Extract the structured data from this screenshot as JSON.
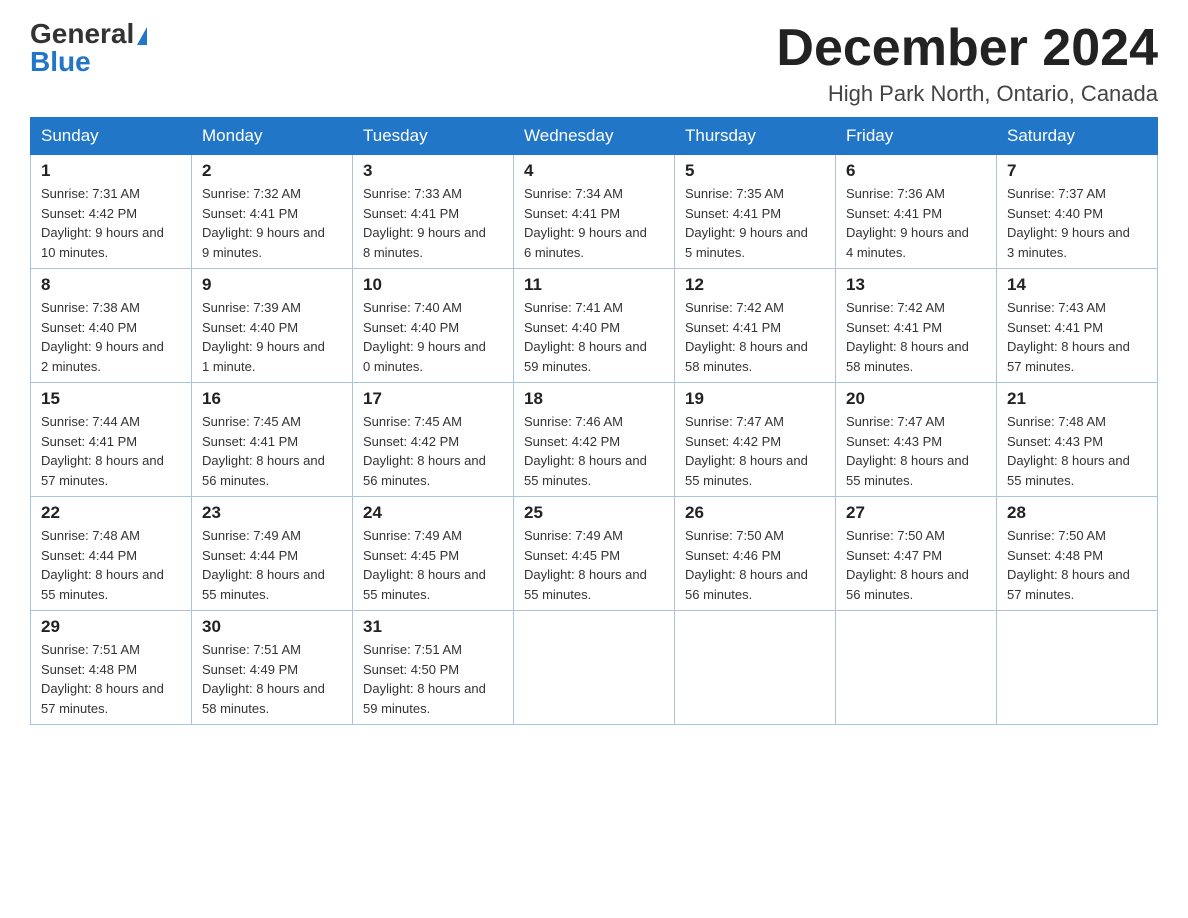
{
  "header": {
    "logo_general": "General",
    "logo_blue": "Blue",
    "month_title": "December 2024",
    "location": "High Park North, Ontario, Canada"
  },
  "days_of_week": [
    "Sunday",
    "Monday",
    "Tuesday",
    "Wednesday",
    "Thursday",
    "Friday",
    "Saturday"
  ],
  "weeks": [
    [
      {
        "day": "1",
        "sunrise": "7:31 AM",
        "sunset": "4:42 PM",
        "daylight": "9 hours and 10 minutes."
      },
      {
        "day": "2",
        "sunrise": "7:32 AM",
        "sunset": "4:41 PM",
        "daylight": "9 hours and 9 minutes."
      },
      {
        "day": "3",
        "sunrise": "7:33 AM",
        "sunset": "4:41 PM",
        "daylight": "9 hours and 8 minutes."
      },
      {
        "day": "4",
        "sunrise": "7:34 AM",
        "sunset": "4:41 PM",
        "daylight": "9 hours and 6 minutes."
      },
      {
        "day": "5",
        "sunrise": "7:35 AM",
        "sunset": "4:41 PM",
        "daylight": "9 hours and 5 minutes."
      },
      {
        "day": "6",
        "sunrise": "7:36 AM",
        "sunset": "4:41 PM",
        "daylight": "9 hours and 4 minutes."
      },
      {
        "day": "7",
        "sunrise": "7:37 AM",
        "sunset": "4:40 PM",
        "daylight": "9 hours and 3 minutes."
      }
    ],
    [
      {
        "day": "8",
        "sunrise": "7:38 AM",
        "sunset": "4:40 PM",
        "daylight": "9 hours and 2 minutes."
      },
      {
        "day": "9",
        "sunrise": "7:39 AM",
        "sunset": "4:40 PM",
        "daylight": "9 hours and 1 minute."
      },
      {
        "day": "10",
        "sunrise": "7:40 AM",
        "sunset": "4:40 PM",
        "daylight": "9 hours and 0 minutes."
      },
      {
        "day": "11",
        "sunrise": "7:41 AM",
        "sunset": "4:40 PM",
        "daylight": "8 hours and 59 minutes."
      },
      {
        "day": "12",
        "sunrise": "7:42 AM",
        "sunset": "4:41 PM",
        "daylight": "8 hours and 58 minutes."
      },
      {
        "day": "13",
        "sunrise": "7:42 AM",
        "sunset": "4:41 PM",
        "daylight": "8 hours and 58 minutes."
      },
      {
        "day": "14",
        "sunrise": "7:43 AM",
        "sunset": "4:41 PM",
        "daylight": "8 hours and 57 minutes."
      }
    ],
    [
      {
        "day": "15",
        "sunrise": "7:44 AM",
        "sunset": "4:41 PM",
        "daylight": "8 hours and 57 minutes."
      },
      {
        "day": "16",
        "sunrise": "7:45 AM",
        "sunset": "4:41 PM",
        "daylight": "8 hours and 56 minutes."
      },
      {
        "day": "17",
        "sunrise": "7:45 AM",
        "sunset": "4:42 PM",
        "daylight": "8 hours and 56 minutes."
      },
      {
        "day": "18",
        "sunrise": "7:46 AM",
        "sunset": "4:42 PM",
        "daylight": "8 hours and 55 minutes."
      },
      {
        "day": "19",
        "sunrise": "7:47 AM",
        "sunset": "4:42 PM",
        "daylight": "8 hours and 55 minutes."
      },
      {
        "day": "20",
        "sunrise": "7:47 AM",
        "sunset": "4:43 PM",
        "daylight": "8 hours and 55 minutes."
      },
      {
        "day": "21",
        "sunrise": "7:48 AM",
        "sunset": "4:43 PM",
        "daylight": "8 hours and 55 minutes."
      }
    ],
    [
      {
        "day": "22",
        "sunrise": "7:48 AM",
        "sunset": "4:44 PM",
        "daylight": "8 hours and 55 minutes."
      },
      {
        "day": "23",
        "sunrise": "7:49 AM",
        "sunset": "4:44 PM",
        "daylight": "8 hours and 55 minutes."
      },
      {
        "day": "24",
        "sunrise": "7:49 AM",
        "sunset": "4:45 PM",
        "daylight": "8 hours and 55 minutes."
      },
      {
        "day": "25",
        "sunrise": "7:49 AM",
        "sunset": "4:45 PM",
        "daylight": "8 hours and 55 minutes."
      },
      {
        "day": "26",
        "sunrise": "7:50 AM",
        "sunset": "4:46 PM",
        "daylight": "8 hours and 56 minutes."
      },
      {
        "day": "27",
        "sunrise": "7:50 AM",
        "sunset": "4:47 PM",
        "daylight": "8 hours and 56 minutes."
      },
      {
        "day": "28",
        "sunrise": "7:50 AM",
        "sunset": "4:48 PM",
        "daylight": "8 hours and 57 minutes."
      }
    ],
    [
      {
        "day": "29",
        "sunrise": "7:51 AM",
        "sunset": "4:48 PM",
        "daylight": "8 hours and 57 minutes."
      },
      {
        "day": "30",
        "sunrise": "7:51 AM",
        "sunset": "4:49 PM",
        "daylight": "8 hours and 58 minutes."
      },
      {
        "day": "31",
        "sunrise": "7:51 AM",
        "sunset": "4:50 PM",
        "daylight": "8 hours and 59 minutes."
      },
      null,
      null,
      null,
      null
    ]
  ],
  "labels": {
    "sunrise": "Sunrise:",
    "sunset": "Sunset:",
    "daylight": "Daylight:"
  }
}
